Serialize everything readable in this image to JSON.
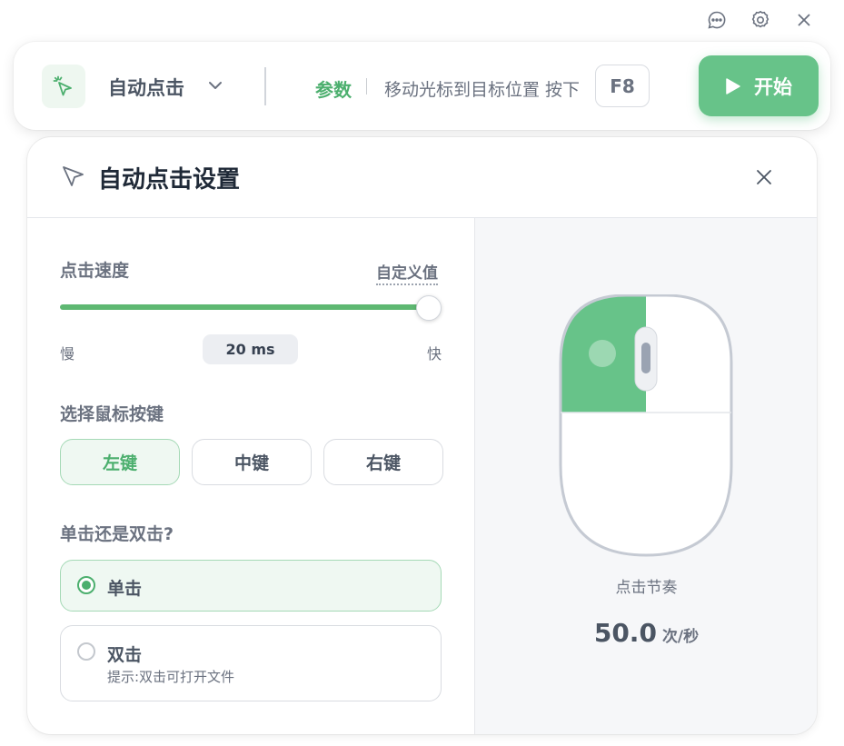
{
  "window": {
    "icons": [
      "chat-icon",
      "gear-icon",
      "close-icon"
    ]
  },
  "toolbar": {
    "mode_label": "自动点击",
    "params_label": "参数",
    "hint": "移动光标到目标位置 按下",
    "hotkey": "F8",
    "start_label": "开始"
  },
  "panel": {
    "title": "自动点击设置",
    "speed": {
      "label": "点击速度",
      "custom_label": "自定义值",
      "slow": "慢",
      "fast": "快",
      "value": "20 ms",
      "slider_level": 1.0
    },
    "mouse_button": {
      "label": "选择鼠标按键",
      "options": [
        "左键",
        "中键",
        "右键"
      ],
      "selected": "左键"
    },
    "click_type": {
      "label": "单击还是双击?",
      "single": "单击",
      "double": "双击",
      "double_hint": "提示:双击可打开文件",
      "selected": "单击"
    },
    "rhythm": {
      "label": "点击节奏",
      "value": "50.0",
      "unit": "次/秒"
    }
  },
  "colors": {
    "accent": "#67c389",
    "accent_text": "#4caf6e",
    "active_bg": "#eff8f2"
  }
}
